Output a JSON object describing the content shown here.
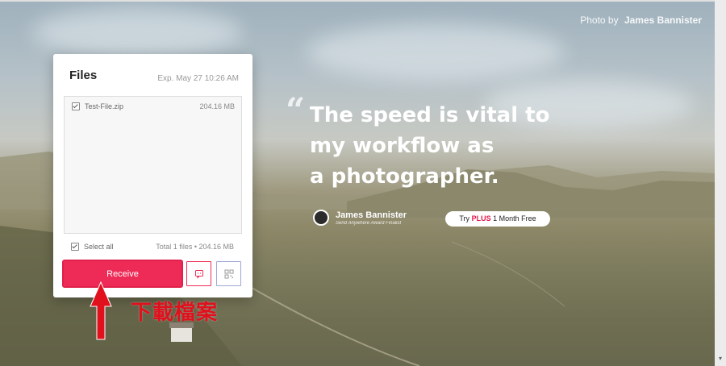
{
  "background": {
    "photo_credit_prefix": "Photo by",
    "photo_credit_name": "James Bannister"
  },
  "promo": {
    "quote_lines": [
      "The speed is vital to",
      "my workflow as",
      "a photographer."
    ],
    "author_name": "James Bannister",
    "author_subtitle": "Send Anywhere Award Finalist",
    "plus_button_prefix": "Try",
    "plus_button_highlight": "PLUS",
    "plus_button_suffix": "1 Month Free"
  },
  "files_panel": {
    "title": "Files",
    "expiration": "Exp. May 27 10:26 AM",
    "files": [
      {
        "name": "Test-File.zip",
        "size": "204.16 MB",
        "checked": true
      }
    ],
    "select_all_label": "Select all",
    "total_label": "Total 1 files • 204.16 MB",
    "receive_label": "Receive"
  },
  "annotation": {
    "text": "下載檔案",
    "color": "#e0101c"
  },
  "colors": {
    "accent": "#ee2b57",
    "panel_bg": "#ffffff"
  }
}
